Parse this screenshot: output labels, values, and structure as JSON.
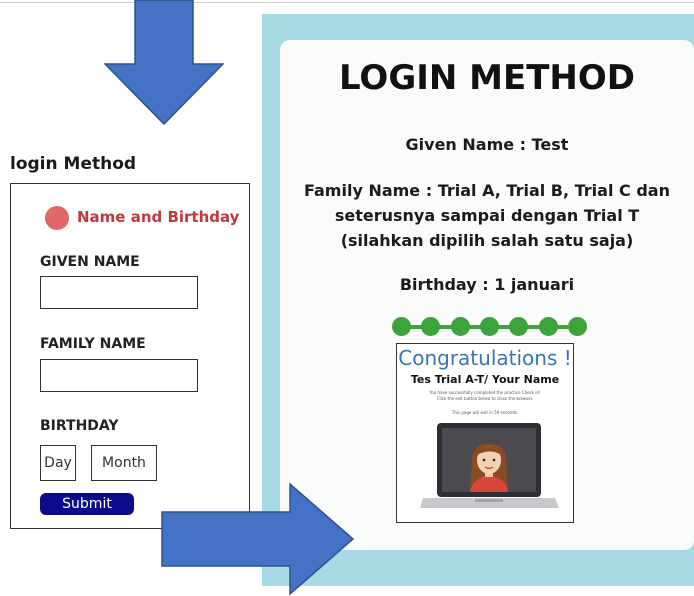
{
  "form": {
    "title": "login Method",
    "radio_label": "Name and Birthday",
    "given_label": "GIVEN NAME",
    "family_label": "FAMILY NAME",
    "birthday_label": "BIRTHDAY",
    "day_placeholder": "Day",
    "month_placeholder": "Month",
    "submit_label": "Submit"
  },
  "panel": {
    "title": "LOGIN METHOD",
    "given": "Given Name : Test",
    "family_line1": "Family Name : Trial A, Trial B, Trial C dan",
    "family_line2": "seterusnya sampai dengan Trial T",
    "family_line3": "(silahkan dipilih salah satu saja)",
    "birthday": "Birthday : 1 januari",
    "progress_steps": 7
  },
  "screenshot": {
    "congrats": "Congratulations !",
    "trial_name": "Tes Trial A-T/ Your Name",
    "small_line1": "You have successfully completed the practice Check in!",
    "small_line2": "Click the exit button below to close the browser.",
    "small_line3": "This page will exit in 59 seconds."
  },
  "colors": {
    "arrow": "#4472c4",
    "panel_bg": "#a8dae6",
    "radio": "#e06868",
    "submit": "#0b0b8c",
    "progress": "#3da33d"
  }
}
